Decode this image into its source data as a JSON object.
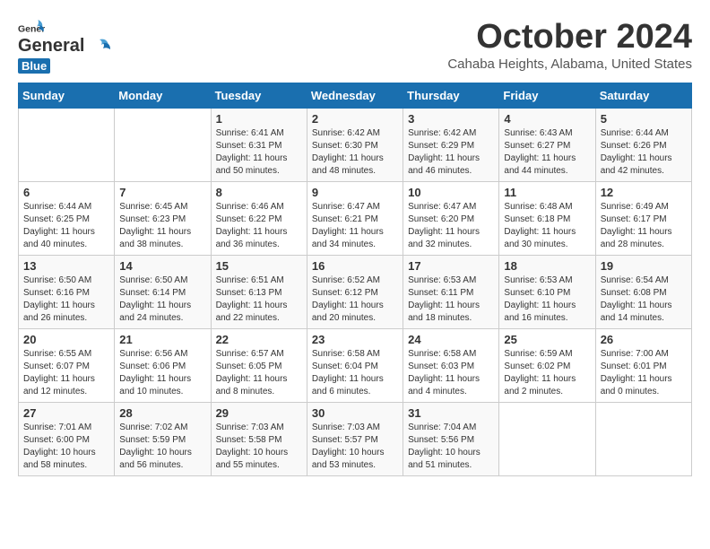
{
  "header": {
    "logo_general": "General",
    "logo_blue": "Blue",
    "month": "October 2024",
    "location": "Cahaba Heights, Alabama, United States"
  },
  "weekdays": [
    "Sunday",
    "Monday",
    "Tuesday",
    "Wednesday",
    "Thursday",
    "Friday",
    "Saturday"
  ],
  "weeks": [
    [
      {
        "day": "",
        "content": ""
      },
      {
        "day": "",
        "content": ""
      },
      {
        "day": "1",
        "content": "Sunrise: 6:41 AM\nSunset: 6:31 PM\nDaylight: 11 hours\nand 50 minutes."
      },
      {
        "day": "2",
        "content": "Sunrise: 6:42 AM\nSunset: 6:30 PM\nDaylight: 11 hours\nand 48 minutes."
      },
      {
        "day": "3",
        "content": "Sunrise: 6:42 AM\nSunset: 6:29 PM\nDaylight: 11 hours\nand 46 minutes."
      },
      {
        "day": "4",
        "content": "Sunrise: 6:43 AM\nSunset: 6:27 PM\nDaylight: 11 hours\nand 44 minutes."
      },
      {
        "day": "5",
        "content": "Sunrise: 6:44 AM\nSunset: 6:26 PM\nDaylight: 11 hours\nand 42 minutes."
      }
    ],
    [
      {
        "day": "6",
        "content": "Sunrise: 6:44 AM\nSunset: 6:25 PM\nDaylight: 11 hours\nand 40 minutes."
      },
      {
        "day": "7",
        "content": "Sunrise: 6:45 AM\nSunset: 6:23 PM\nDaylight: 11 hours\nand 38 minutes."
      },
      {
        "day": "8",
        "content": "Sunrise: 6:46 AM\nSunset: 6:22 PM\nDaylight: 11 hours\nand 36 minutes."
      },
      {
        "day": "9",
        "content": "Sunrise: 6:47 AM\nSunset: 6:21 PM\nDaylight: 11 hours\nand 34 minutes."
      },
      {
        "day": "10",
        "content": "Sunrise: 6:47 AM\nSunset: 6:20 PM\nDaylight: 11 hours\nand 32 minutes."
      },
      {
        "day": "11",
        "content": "Sunrise: 6:48 AM\nSunset: 6:18 PM\nDaylight: 11 hours\nand 30 minutes."
      },
      {
        "day": "12",
        "content": "Sunrise: 6:49 AM\nSunset: 6:17 PM\nDaylight: 11 hours\nand 28 minutes."
      }
    ],
    [
      {
        "day": "13",
        "content": "Sunrise: 6:50 AM\nSunset: 6:16 PM\nDaylight: 11 hours\nand 26 minutes."
      },
      {
        "day": "14",
        "content": "Sunrise: 6:50 AM\nSunset: 6:14 PM\nDaylight: 11 hours\nand 24 minutes."
      },
      {
        "day": "15",
        "content": "Sunrise: 6:51 AM\nSunset: 6:13 PM\nDaylight: 11 hours\nand 22 minutes."
      },
      {
        "day": "16",
        "content": "Sunrise: 6:52 AM\nSunset: 6:12 PM\nDaylight: 11 hours\nand 20 minutes."
      },
      {
        "day": "17",
        "content": "Sunrise: 6:53 AM\nSunset: 6:11 PM\nDaylight: 11 hours\nand 18 minutes."
      },
      {
        "day": "18",
        "content": "Sunrise: 6:53 AM\nSunset: 6:10 PM\nDaylight: 11 hours\nand 16 minutes."
      },
      {
        "day": "19",
        "content": "Sunrise: 6:54 AM\nSunset: 6:08 PM\nDaylight: 11 hours\nand 14 minutes."
      }
    ],
    [
      {
        "day": "20",
        "content": "Sunrise: 6:55 AM\nSunset: 6:07 PM\nDaylight: 11 hours\nand 12 minutes."
      },
      {
        "day": "21",
        "content": "Sunrise: 6:56 AM\nSunset: 6:06 PM\nDaylight: 11 hours\nand 10 minutes."
      },
      {
        "day": "22",
        "content": "Sunrise: 6:57 AM\nSunset: 6:05 PM\nDaylight: 11 hours\nand 8 minutes."
      },
      {
        "day": "23",
        "content": "Sunrise: 6:58 AM\nSunset: 6:04 PM\nDaylight: 11 hours\nand 6 minutes."
      },
      {
        "day": "24",
        "content": "Sunrise: 6:58 AM\nSunset: 6:03 PM\nDaylight: 11 hours\nand 4 minutes."
      },
      {
        "day": "25",
        "content": "Sunrise: 6:59 AM\nSunset: 6:02 PM\nDaylight: 11 hours\nand 2 minutes."
      },
      {
        "day": "26",
        "content": "Sunrise: 7:00 AM\nSunset: 6:01 PM\nDaylight: 11 hours\nand 0 minutes."
      }
    ],
    [
      {
        "day": "27",
        "content": "Sunrise: 7:01 AM\nSunset: 6:00 PM\nDaylight: 10 hours\nand 58 minutes."
      },
      {
        "day": "28",
        "content": "Sunrise: 7:02 AM\nSunset: 5:59 PM\nDaylight: 10 hours\nand 56 minutes."
      },
      {
        "day": "29",
        "content": "Sunrise: 7:03 AM\nSunset: 5:58 PM\nDaylight: 10 hours\nand 55 minutes."
      },
      {
        "day": "30",
        "content": "Sunrise: 7:03 AM\nSunset: 5:57 PM\nDaylight: 10 hours\nand 53 minutes."
      },
      {
        "day": "31",
        "content": "Sunrise: 7:04 AM\nSunset: 5:56 PM\nDaylight: 10 hours\nand 51 minutes."
      },
      {
        "day": "",
        "content": ""
      },
      {
        "day": "",
        "content": ""
      }
    ]
  ]
}
